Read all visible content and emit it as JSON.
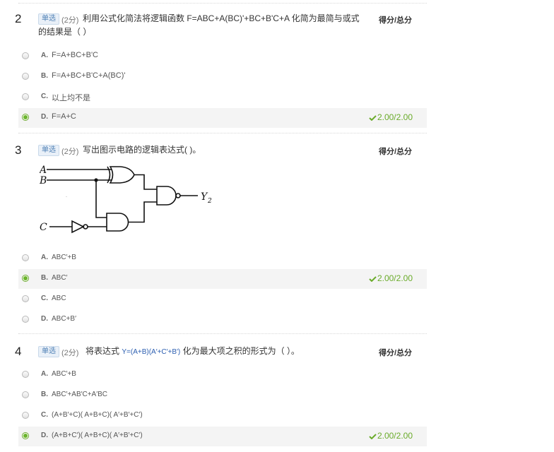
{
  "score_header": "得分/总分",
  "questions": [
    {
      "number": "2",
      "type": "单选",
      "points": "(2分)",
      "stem_line1": "利用公式化简法将逻辑函数 F=ABC+A(BC)'+BC+B'C+A 化简为最简与或式",
      "stem_line2": "的结果是（   ）",
      "options": [
        {
          "letter": "A.",
          "text": "F=A+BC+B'C"
        },
        {
          "letter": "B.",
          "text": "F=A+BC+B'C+A(BC)'"
        },
        {
          "letter": "C.",
          "text": "以上均不是"
        },
        {
          "letter": "D.",
          "text": "F=A+C"
        }
      ],
      "selected": "D",
      "score": "2.00/2.00"
    },
    {
      "number": "3",
      "type": "单选",
      "points": "(2分)",
      "stem": "写出图示电路的逻辑表达式(     )。",
      "figure_labels": {
        "a": "A",
        "b": "B",
        "c": "C",
        "y": "Y",
        "y_sub": "2"
      },
      "options": [
        {
          "letter": "A.",
          "text": "ABC′+B"
        },
        {
          "letter": "B.",
          "text": "ABC′"
        },
        {
          "letter": "C.",
          "text": "ABC"
        },
        {
          "letter": "D.",
          "text": "ABC+B′"
        }
      ],
      "selected": "B",
      "score": "2.00/2.00"
    },
    {
      "number": "4",
      "type": "单选",
      "points": "(2分)",
      "stem_pre": "将表达式",
      "stem_expr": "Y=(A+B)(A′+C′+B′)",
      "stem_post": "化为最大项之积的形式为（    ）。",
      "options": [
        {
          "letter": "A.",
          "text": "ABC′+B"
        },
        {
          "letter": "B.",
          "text": "ABC′+AB′C+A′BC"
        },
        {
          "letter": "C.",
          "text": "(A+B′+C)( A+B+C)( A′+B′+C′)"
        },
        {
          "letter": "D.",
          "text": "(A+B+C′)( A+B+C)( A′+B′+C′)"
        }
      ],
      "selected": "D",
      "score": "2.00/2.00"
    }
  ],
  "colors": {
    "accent_green": "#6aab2a",
    "tag_blue": "#4d7fb5",
    "expr_blue": "#2a5db0"
  }
}
